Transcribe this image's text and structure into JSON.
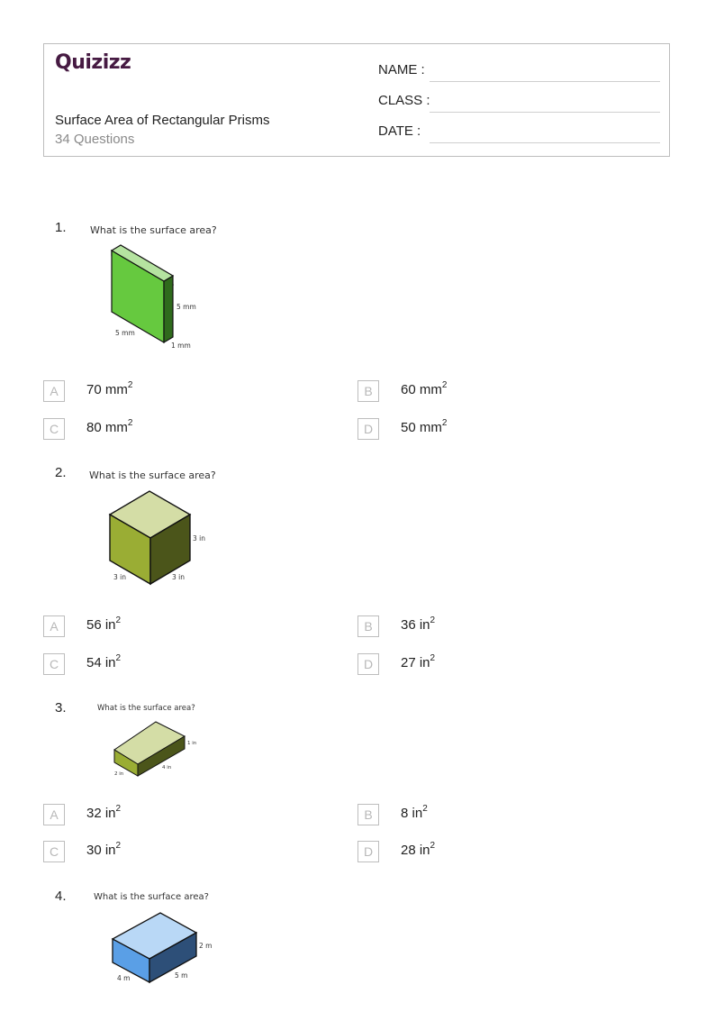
{
  "header": {
    "logo": "Quizizz",
    "title": "Surface Area of Rectangular Prisms",
    "question_count": "34 Questions",
    "fields": [
      {
        "label": "NAME :"
      },
      {
        "label": "CLASS :"
      },
      {
        "label": "DATE  :"
      }
    ]
  },
  "colors": {
    "logo": "#461a42",
    "q1_front": "#66c93f",
    "q1_top": "#b5e3a0",
    "q1_side": "#2f6a1c",
    "q2_front": "#9aad34",
    "q2_top": "#d4dda6",
    "q2_side": "#4b551a",
    "q4_front": "#5a9fe6",
    "q4_top": "#b9d8f6",
    "q4_side": "#2d4f78"
  },
  "questions": [
    {
      "number": "1.",
      "prompt": "What is the surface area?",
      "figure": {
        "labels": [
          "5 mm",
          "5 mm",
          "1 mm"
        ]
      },
      "options": [
        {
          "letter": "A",
          "value": "70 mm",
          "sup": "2"
        },
        {
          "letter": "B",
          "value": "60 mm",
          "sup": "2"
        },
        {
          "letter": "C",
          "value": "80 mm",
          "sup": "2"
        },
        {
          "letter": "D",
          "value": "50 mm",
          "sup": "2"
        }
      ]
    },
    {
      "number": "2.",
      "prompt": "What is the surface area?",
      "figure": {
        "labels": [
          "3 in",
          "3 in",
          "3 in"
        ]
      },
      "options": [
        {
          "letter": "A",
          "value": "56 in",
          "sup": "2"
        },
        {
          "letter": "B",
          "value": "36 in",
          "sup": "2"
        },
        {
          "letter": "C",
          "value": "54 in",
          "sup": "2"
        },
        {
          "letter": "D",
          "value": "27 in",
          "sup": "2"
        }
      ]
    },
    {
      "number": "3.",
      "prompt": "What is the surface area?",
      "figure": {
        "labels": [
          "1 in",
          "4 in",
          "2 in"
        ]
      },
      "options": [
        {
          "letter": "A",
          "value": "32 in",
          "sup": "2"
        },
        {
          "letter": "B",
          "value": "8 in",
          "sup": "2"
        },
        {
          "letter": "C",
          "value": "30 in",
          "sup": "2"
        },
        {
          "letter": "D",
          "value": "28 in",
          "sup": "2"
        }
      ]
    },
    {
      "number": "4.",
      "prompt": "What is the surface area?",
      "figure": {
        "labels": [
          "2 m",
          "5 m",
          "4 m"
        ]
      },
      "options": []
    }
  ]
}
